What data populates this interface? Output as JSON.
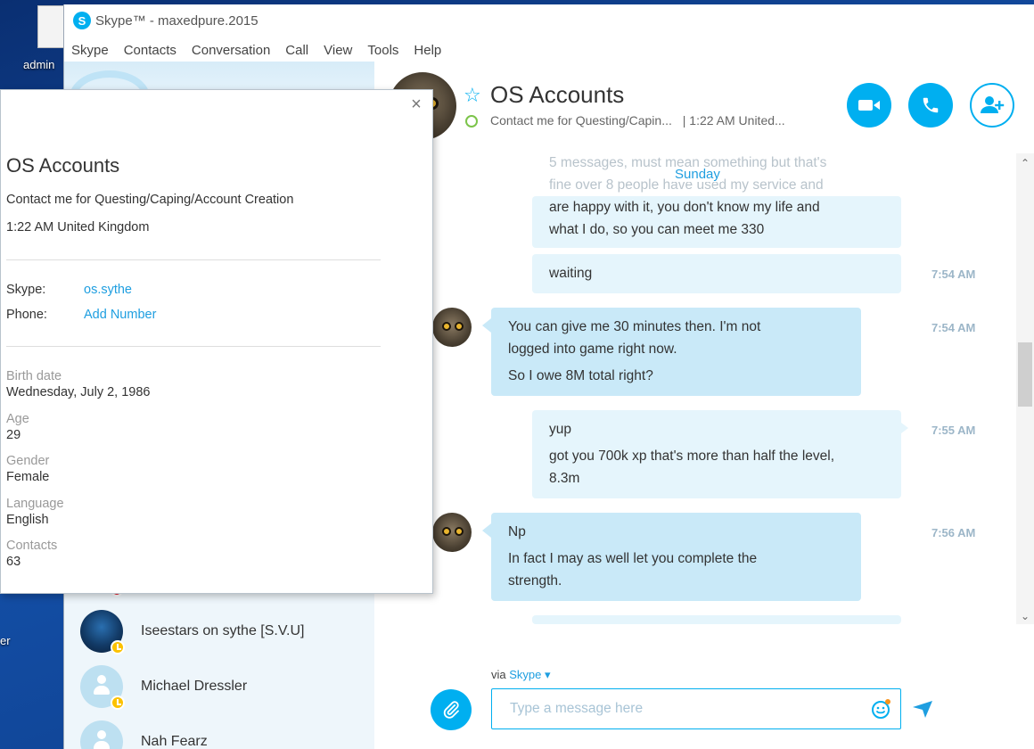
{
  "desktop": {
    "icon_label": "admin",
    "icon_label_2": "er"
  },
  "window": {
    "title": "Skype™ - maxedpure.2015",
    "menu": [
      "Skype",
      "Contacts",
      "Conversation",
      "Call",
      "View",
      "Tools",
      "Help"
    ]
  },
  "contacts": [
    {
      "name": "Iseestars on sythe [S.V.U]",
      "status": "away"
    },
    {
      "name": "Michael Dressler",
      "status": "away"
    },
    {
      "name": "Nah Fearz",
      "status": "unknown"
    }
  ],
  "conversation": {
    "name": "OS Accounts",
    "mood": "Contact me for Questing/Capin...",
    "local_time": "| 1:22 AM United...",
    "day_label": "Sunday",
    "faded_text": [
      "5 messages, must mean something but that's",
      "fine over 8 people have used my service and"
    ],
    "messages": [
      {
        "direction": "out",
        "lines": [
          "are happy with it, you don't know my life and",
          "what I do, so you can meet me 330"
        ],
        "time": ""
      },
      {
        "direction": "out",
        "lines": [
          "waiting"
        ],
        "time": "7:54 AM"
      },
      {
        "direction": "in",
        "lines": [
          "You can give me 30 minutes then. I'm not",
          "logged into game right now.",
          "So I owe 8M total right?"
        ],
        "time": "7:54 AM"
      },
      {
        "direction": "out",
        "lines": [
          "yup",
          "got you 700k xp that's more than half the level,",
          "8.3m"
        ],
        "time": "7:55 AM"
      },
      {
        "direction": "in",
        "lines": [
          "Np",
          "In fact I may as well let you complete the",
          "strength."
        ],
        "time": "7:56 AM"
      }
    ]
  },
  "compose": {
    "via_prefix": "via",
    "via_service": "Skype ▾",
    "placeholder": "Type a message here"
  },
  "profile": {
    "name": "OS Accounts",
    "mood": "Contact me for Questing/Caping/Account Creation",
    "location": "1:22 AM United Kingdom",
    "skype_label": "Skype:",
    "skype_value": "os.sythe",
    "phone_label": "Phone:",
    "phone_value": "Add Number",
    "fields": [
      {
        "label": "Birth date",
        "value": "Wednesday, July 2, 1986"
      },
      {
        "label": "Age",
        "value": "29"
      },
      {
        "label": "Gender",
        "value": "Female"
      },
      {
        "label": "Language",
        "value": "English"
      },
      {
        "label": "Contacts",
        "value": "63"
      }
    ]
  },
  "colors": {
    "accent": "#00aff0",
    "incoming_bubble": "#c9e9f8",
    "outgoing_bubble": "#e5f5fc",
    "away_status": "#fcc200",
    "online_ring": "#7cc44a"
  }
}
